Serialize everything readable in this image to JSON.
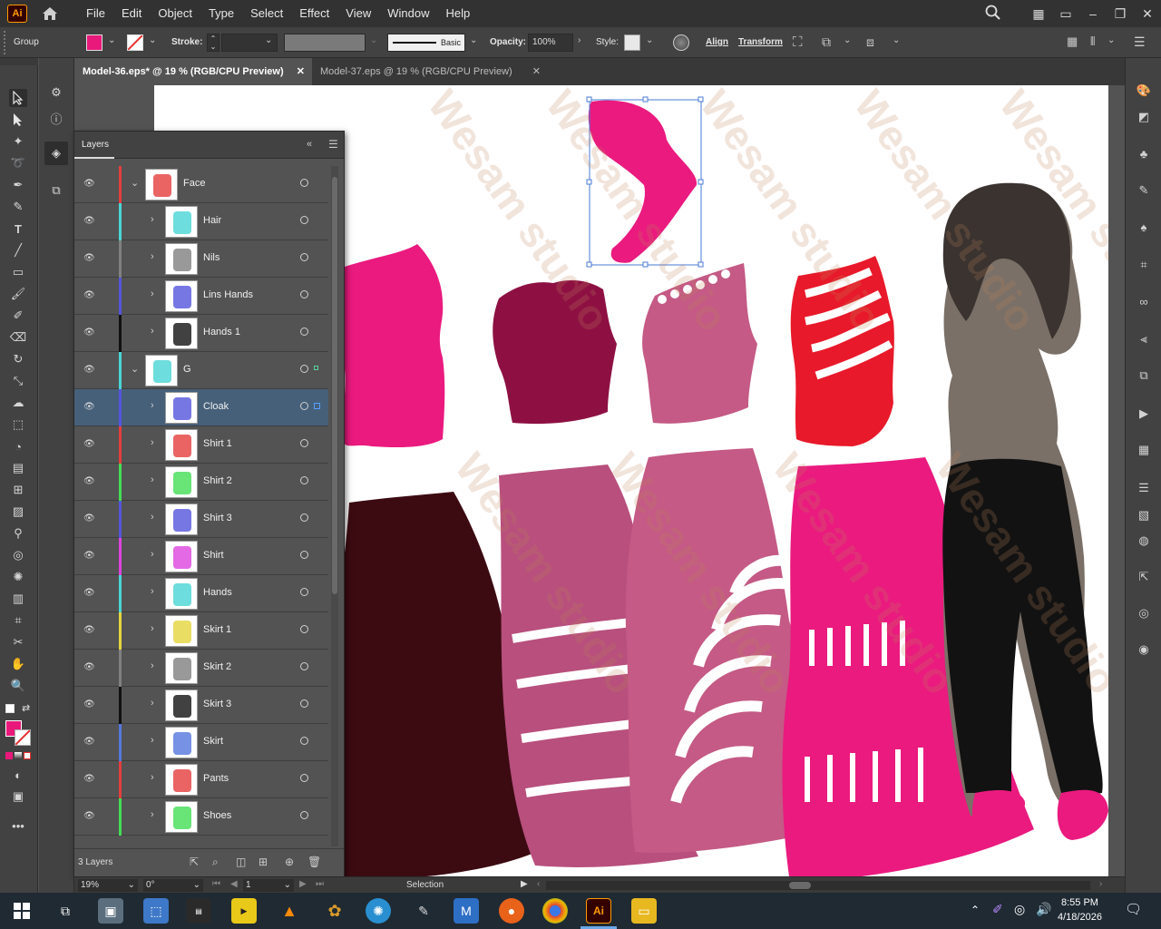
{
  "app": {
    "logo": "Ai",
    "icon": "home-icon"
  },
  "menu": [
    "File",
    "Edit",
    "Object",
    "Type",
    "Select",
    "Effect",
    "View",
    "Window",
    "Help"
  ],
  "control": {
    "selection_label": "Group",
    "fill_color": "#e8197a",
    "stroke_label": "Stroke:",
    "stroke_style": "Basic",
    "opacity_label": "Opacity:",
    "opacity_value": "100%",
    "style_label": "Style:",
    "align_label": "Align",
    "transform_label": "Transform"
  },
  "tabs": [
    {
      "label": "Model-36.eps* @ 19 % (RGB/CPU Preview)",
      "active": true
    },
    {
      "label": "Model-37.eps @ 19 % (RGB/CPU Preview)",
      "active": false
    }
  ],
  "layers_panel": {
    "title": "Layers",
    "rows": [
      {
        "name": "Face",
        "level": 0,
        "color": "#e53d3d",
        "expanded": true
      },
      {
        "name": "Hair",
        "level": 1,
        "color": "#4ad5d5"
      },
      {
        "name": "Nils",
        "level": 1,
        "color": "#808080"
      },
      {
        "name": "Lins Hands",
        "level": 1,
        "color": "#5555dd"
      },
      {
        "name": "Hands 1",
        "level": 1,
        "color": "#111111"
      },
      {
        "name": "G",
        "level": 0,
        "color": "#4ad5d5",
        "expanded": true
      },
      {
        "name": "Cloak",
        "level": 1,
        "color": "#5555dd",
        "selected": true
      },
      {
        "name": "Shirt 1",
        "level": 1,
        "color": "#e53d3d"
      },
      {
        "name": "Shirt 2",
        "level": 1,
        "color": "#44dd55"
      },
      {
        "name": "Shirt 3",
        "level": 1,
        "color": "#5555dd"
      },
      {
        "name": "Shirt",
        "level": 1,
        "color": "#dd44dd"
      },
      {
        "name": "Hands",
        "level": 1,
        "color": "#4ad5d5"
      },
      {
        "name": "Skirt 1",
        "level": 1,
        "color": "#e5d53d"
      },
      {
        "name": "Skirt 2",
        "level": 1,
        "color": "#808080"
      },
      {
        "name": "Skirt 3",
        "level": 1,
        "color": "#111111"
      },
      {
        "name": "Skirt",
        "level": 1,
        "color": "#5577dd"
      },
      {
        "name": "Pants",
        "level": 1,
        "color": "#e53d3d"
      },
      {
        "name": "Shoes",
        "level": 1,
        "color": "#44dd55"
      }
    ],
    "footer_count": "3 Layers"
  },
  "status": {
    "zoom": "19%",
    "rotation": "0°",
    "artboard": "1",
    "tool": "Selection"
  },
  "taskbar": {
    "time": "8:55 PM",
    "date": "4/18/2026"
  },
  "watermark_text": "Wesam studio"
}
